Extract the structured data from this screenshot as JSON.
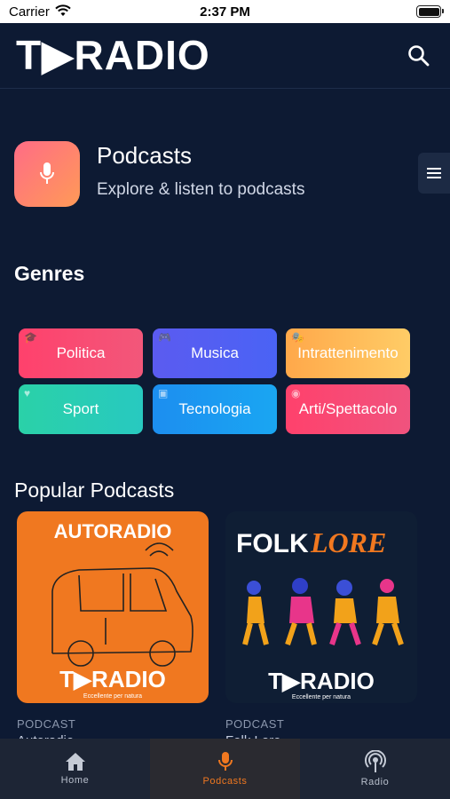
{
  "status": {
    "carrier": "Carrier",
    "time": "2:37 PM"
  },
  "header": {
    "logo": "T▶RADIO"
  },
  "hero": {
    "title": "Podcasts",
    "subtitle": "Explore & listen to podcasts"
  },
  "genres": {
    "title": "Genres",
    "items": [
      {
        "label": "Politica"
      },
      {
        "label": "Musica"
      },
      {
        "label": "Intrattenimento"
      },
      {
        "label": "Sport"
      },
      {
        "label": "Tecnologia"
      },
      {
        "label": "Arti/Spettacolo"
      }
    ]
  },
  "popular": {
    "title": "Popular Podcasts",
    "items": [
      {
        "type": "PODCAST",
        "name": "Autoradio",
        "art_title": "AUTORADIO",
        "art_brand": "T▶RADIO",
        "art_tagline": "Eccellente per natura"
      },
      {
        "type": "PODCAST",
        "name": "Folk Lore",
        "art_title_a": "FOLK",
        "art_title_b": "LORE",
        "art_brand": "T▶RADIO",
        "art_tagline": "Eccellente per natura"
      }
    ]
  },
  "tabs": [
    {
      "label": "Home",
      "icon": "home-icon",
      "active": false
    },
    {
      "label": "Podcasts",
      "icon": "microphone-icon",
      "active": true
    },
    {
      "label": "Radio",
      "icon": "radio-icon",
      "active": false
    }
  ],
  "colors": {
    "background": "#0d1a33",
    "accent": "#f07820",
    "tab_bar": "#1d2535"
  }
}
